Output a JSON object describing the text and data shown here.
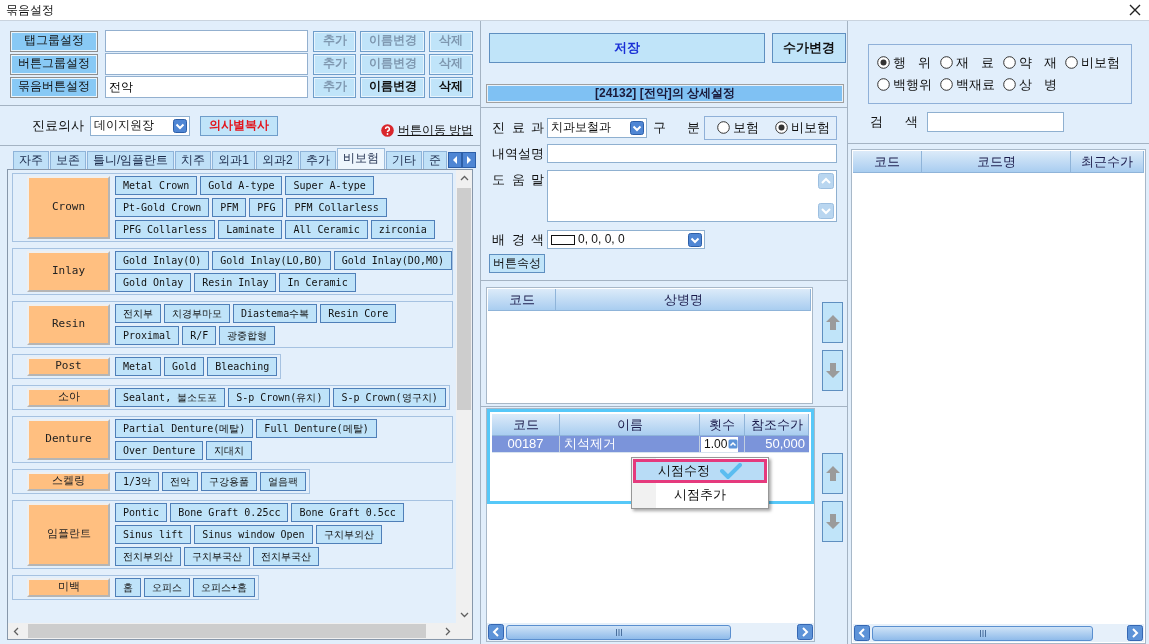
{
  "window": {
    "title": "묶음설정"
  },
  "group_settings": [
    {
      "label": "탭그룹설정",
      "buttons": [
        {
          "label": "추가",
          "disabled": true
        },
        {
          "label": "이름변경",
          "disabled": true
        },
        {
          "label": "삭제",
          "disabled": true
        }
      ]
    },
    {
      "label": "버튼그룹설정",
      "buttons": [
        {
          "label": "추가",
          "disabled": true
        },
        {
          "label": "이름변경",
          "disabled": true
        },
        {
          "label": "삭제",
          "disabled": true
        }
      ]
    },
    {
      "label": "묶음버튼설정",
      "value": "전악",
      "buttons": [
        {
          "label": "추가",
          "disabled": true
        },
        {
          "label": "이름변경",
          "disabled": false
        },
        {
          "label": "삭제",
          "disabled": false
        }
      ]
    }
  ],
  "doctor": {
    "label": "진료의사",
    "value": "데이지원장",
    "copy_button": "의사별복사"
  },
  "help_link": "버튼이동 방법",
  "tabs": [
    {
      "label": "자주",
      "selected": false
    },
    {
      "label": "보존",
      "selected": false
    },
    {
      "label": "틀니/임플란트",
      "selected": false
    },
    {
      "label": "치주",
      "selected": false
    },
    {
      "label": "외과1",
      "selected": false
    },
    {
      "label": "외과2",
      "selected": false
    },
    {
      "label": "추가",
      "selected": false
    },
    {
      "label": "비보험",
      "selected": true
    },
    {
      "label": "기타",
      "selected": false
    },
    {
      "label": "준",
      "selected": false
    }
  ],
  "groups": [
    {
      "category": "Crown",
      "lines": [
        {
          "buttons": [
            "Metal Crown",
            "Gold A-type",
            "Super A-type"
          ]
        },
        {
          "buttons": [
            "Pt-Gold Crown",
            "PFM",
            "PFG",
            "PFM Collarless"
          ]
        },
        {
          "buttons": [
            "PFG Collarless",
            "Laminate",
            "All Ceramic",
            "zirconia"
          ]
        }
      ]
    },
    {
      "category": "Inlay",
      "lines": [
        {
          "buttons": [
            "Gold Inlay(O)",
            "Gold Inlay(LO,BO)",
            "Gold Inlay(DO,MO)"
          ]
        },
        {
          "buttons": [
            "Gold Onlay",
            "Resin Inlay",
            "In Ceramic"
          ]
        }
      ]
    },
    {
      "category": "Resin",
      "lines": [
        {
          "buttons": [
            "전치부",
            "치경부마모",
            "Diastema수복",
            "Resin Core"
          ]
        },
        {
          "buttons": [
            "Proximal",
            "R/F",
            "광중합형"
          ]
        }
      ]
    },
    {
      "category": "Post",
      "lines": [
        {
          "buttons": [
            "Metal",
            "Gold",
            "Bleaching"
          ]
        }
      ]
    },
    {
      "category": "소아",
      "lines": [
        {
          "buttons": [
            "Sealant, 불소도포",
            "S-p Crown(유치)",
            "S-p Crown(영구치)"
          ]
        }
      ]
    },
    {
      "category": "Denture",
      "lines": [
        {
          "buttons": [
            "Partial Denture(메탈)",
            "Full Denture(메탈)"
          ]
        },
        {
          "buttons": [
            "Over Denture",
            "지대치"
          ]
        }
      ]
    },
    {
      "category": "스켈링",
      "lines": [
        {
          "buttons": [
            "1/3악",
            "전악",
            "구강용품",
            "얼음팩"
          ]
        }
      ]
    },
    {
      "category": "임플란트",
      "lines": [
        {
          "buttons": [
            "Pontic",
            "Bone Graft 0.25cc",
            "Bone Graft 0.5cc"
          ]
        },
        {
          "buttons": [
            "Sinus lift",
            "Sinus window Open",
            "구치부외산"
          ]
        },
        {
          "buttons": [
            "전치부외산",
            "구치부국산",
            "전치부국산"
          ]
        }
      ]
    },
    {
      "category": "미백",
      "lines": [
        {
          "buttons": [
            "홈",
            "오피스",
            "오피스+홈"
          ]
        }
      ]
    }
  ],
  "actions": {
    "save": "저장",
    "fee_change": "수가변경"
  },
  "detail": {
    "title": "[24132] [전악]의 상세설정",
    "department": {
      "label": "진 료 과",
      "value": "치과보철과"
    },
    "division": {
      "label": "구 분",
      "options": [
        {
          "label": "보험",
          "selected": false
        },
        {
          "label": "비보험",
          "selected": true
        }
      ]
    },
    "description": {
      "label": "내역설명"
    },
    "help_text": {
      "label": "도 움 말"
    },
    "background_color": {
      "label": "배 경 색",
      "value": "0, 0, 0, 0"
    },
    "button_properties": "버튼속성"
  },
  "diagnosis_table": {
    "focused": false,
    "columns": [
      "코드",
      "상병명"
    ]
  },
  "item_table": {
    "focused": true,
    "columns": [
      "코드",
      "이름",
      "횟수",
      "참조수가"
    ],
    "rows": [
      {
        "selected": true,
        "code": "00187",
        "name": "치석제거",
        "count": "1.00",
        "fee": "50,000"
      }
    ]
  },
  "context_menu": [
    {
      "label": "시점수정",
      "selected": true
    },
    {
      "label": "시점추가",
      "selected": false
    }
  ],
  "search_panel": {
    "types": [
      {
        "label": "행 위",
        "selected": true
      },
      {
        "label": "재 료",
        "selected": false
      },
      {
        "label": "약 재",
        "selected": false
      },
      {
        "label": "비보험",
        "selected": false
      },
      {
        "label": "백행위",
        "selected": false
      },
      {
        "label": "백재료",
        "selected": false
      },
      {
        "label": "상 병",
        "selected": false
      }
    ],
    "search": {
      "label": "검 색"
    },
    "table": {
      "columns": [
        "코드",
        "코드명",
        "최근수가"
      ]
    }
  }
}
